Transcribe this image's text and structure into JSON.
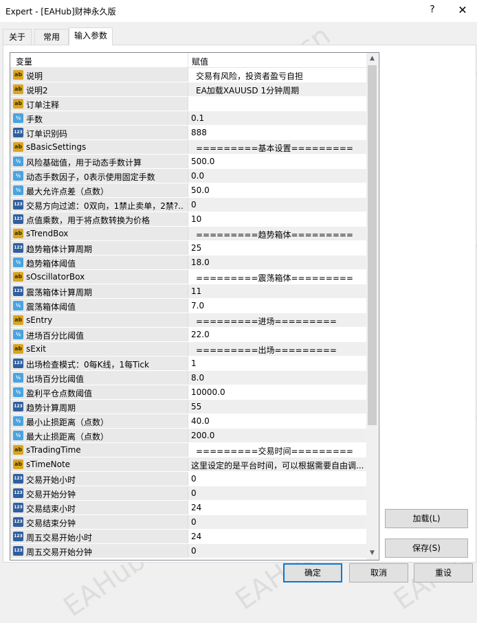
{
  "window": {
    "title": "Expert - [EAHub]财神永久版",
    "help": "?",
    "close": "✕"
  },
  "tabs": [
    {
      "label": "关于"
    },
    {
      "label": "常用"
    },
    {
      "label": "输入参数"
    }
  ],
  "grid": {
    "col_variable": "变量",
    "col_value": "赋值",
    "rows": [
      {
        "icon": "ab",
        "name": "说明",
        "value": "交易有风险，投资者盈亏自担"
      },
      {
        "icon": "ab",
        "name": "说明2",
        "value": "EA加载XAUUSD 1分钟周期"
      },
      {
        "icon": "ab",
        "name": "订单注释",
        "value": ""
      },
      {
        "icon": "v2",
        "name": "手数",
        "value": "0.1"
      },
      {
        "icon": "123",
        "name": "订单识别码",
        "value": "888"
      },
      {
        "icon": "ab",
        "name": "sBasicSettings",
        "value": "=========基本设置========="
      },
      {
        "icon": "v2",
        "name": "风险基础值，用于动态手数计算",
        "value": "500.0"
      },
      {
        "icon": "v2",
        "name": "动态手数因子，0表示使用固定手数",
        "value": "0.0"
      },
      {
        "icon": "v2",
        "name": "最大允许点差（点数）",
        "value": "50.0"
      },
      {
        "icon": "123",
        "name": "交易方向过滤：0双向，1禁止卖单，2禁?..",
        "value": "0"
      },
      {
        "icon": "123",
        "name": "点值乘数，用于将点数转换为价格",
        "value": "10"
      },
      {
        "icon": "ab",
        "name": "sTrendBox",
        "value": "=========趋势箱体========="
      },
      {
        "icon": "123",
        "name": "趋势箱体计算周期",
        "value": "25"
      },
      {
        "icon": "v2",
        "name": "趋势箱体阈值",
        "value": "18.0"
      },
      {
        "icon": "ab",
        "name": "sOscillatorBox",
        "value": "=========震荡箱体========="
      },
      {
        "icon": "123",
        "name": "震荡箱体计算周期",
        "value": "11"
      },
      {
        "icon": "v2",
        "name": "震荡箱体阈值",
        "value": "7.0"
      },
      {
        "icon": "ab",
        "name": "sEntry",
        "value": "=========进场========="
      },
      {
        "icon": "v2",
        "name": "进场百分比阈值",
        "value": "22.0"
      },
      {
        "icon": "ab",
        "name": "sExit",
        "value": "=========出场========="
      },
      {
        "icon": "123",
        "name": "出场检查模式：0每K线，1每Tick",
        "value": "1"
      },
      {
        "icon": "v2",
        "name": "出场百分比阈值",
        "value": "8.0"
      },
      {
        "icon": "v2",
        "name": "盈利平仓点数阈值",
        "value": "10000.0"
      },
      {
        "icon": "123",
        "name": "趋势计算周期",
        "value": "55"
      },
      {
        "icon": "v2",
        "name": "最小止损距离（点数）",
        "value": "40.0"
      },
      {
        "icon": "v2",
        "name": "最大止损距离（点数）",
        "value": "200.0"
      },
      {
        "icon": "ab",
        "name": "sTradingTime",
        "value": "=========交易时间========="
      },
      {
        "icon": "ab",
        "name": "sTimeNote",
        "value": "这里设定的是平台时间，可以根据需要自由调..."
      },
      {
        "icon": "123",
        "name": "交易开始小时",
        "value": "0"
      },
      {
        "icon": "123",
        "name": "交易开始分钟",
        "value": "0"
      },
      {
        "icon": "123",
        "name": "交易结束小时",
        "value": "24"
      },
      {
        "icon": "123",
        "name": "交易结束分钟",
        "value": "0"
      },
      {
        "icon": "123",
        "name": "周五交易开始小时",
        "value": "24"
      },
      {
        "icon": "123",
        "name": "周五交易开始分钟",
        "value": "0"
      }
    ]
  },
  "buttons": {
    "load": "加载(L)",
    "save": "保存(S)",
    "ok": "确定",
    "cancel": "取消",
    "reset": "重设"
  },
  "watermark": "EAHub.cn"
}
